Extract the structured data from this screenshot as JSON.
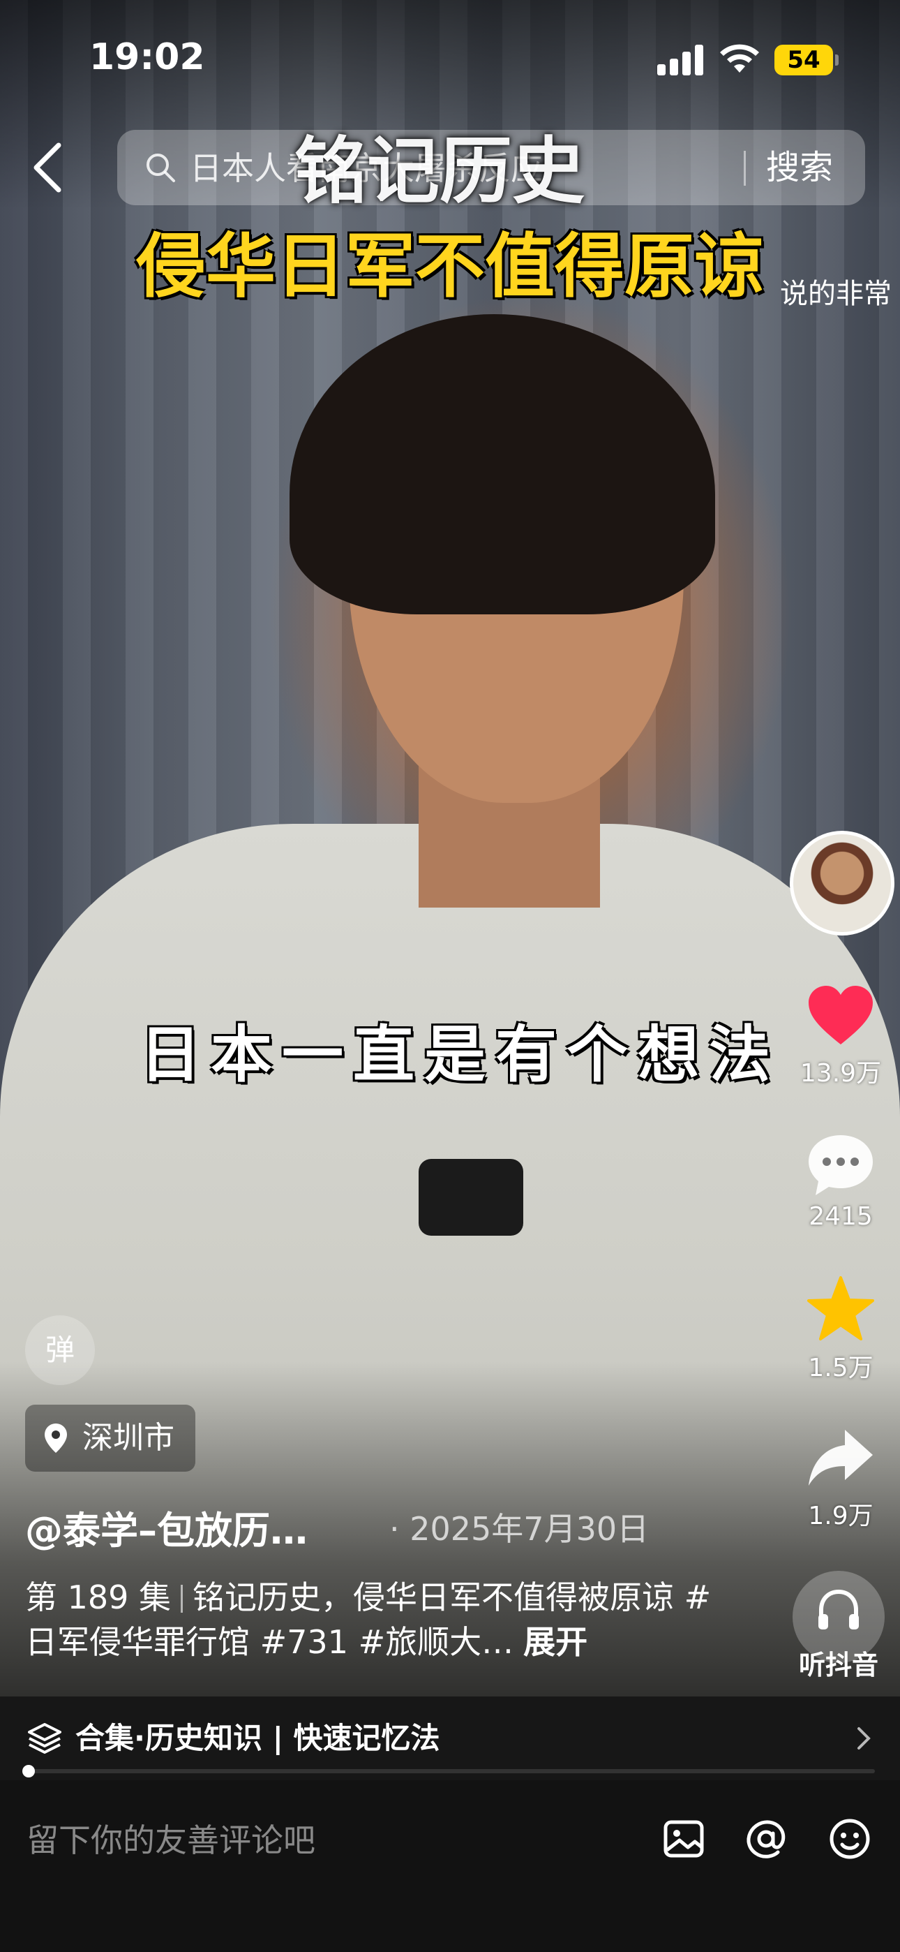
{
  "status_bar": {
    "time": "19:02",
    "battery": "54"
  },
  "search": {
    "placeholder": "日本人看南京大屠杀反应",
    "button": "搜索"
  },
  "video": {
    "title_top": "铭记历史",
    "title_main": "侵华日军不值得原谅",
    "danmu": "说的非常",
    "subtitle": "日本一直是有个想法"
  },
  "actions": {
    "likes": "13.9万",
    "comments": "2415",
    "favorites": "1.5万",
    "shares": "1.9万",
    "listen": "听抖音"
  },
  "danmaku_toggle": "弹",
  "location": "深圳市",
  "author": "@泰学–包放历…",
  "date": "· 2025年7月30日",
  "description": {
    "episode": "第 189 集",
    "text": "铭记历史，侵华日军不值得被原谅 #日军侵华罪行馆 #731 #旅顺大…",
    "expand": "展开"
  },
  "collection": {
    "label": "合集·历史知识 | 快速记忆法",
    "progress": 0.0
  },
  "comment": {
    "placeholder": "留下你的友善评论吧"
  },
  "colors": {
    "like": "#fe2c55",
    "favorite": "#ffc300",
    "title_yellow": "#ffd51e"
  }
}
